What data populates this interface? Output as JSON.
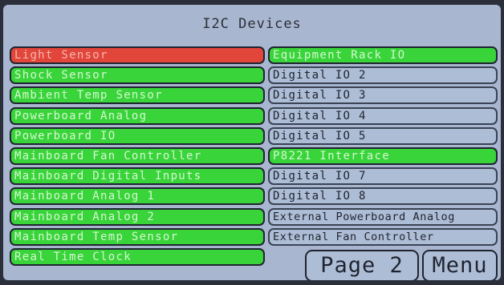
{
  "title": "I2C Devices",
  "left_items": [
    {
      "label": "Light Sensor",
      "status": "error"
    },
    {
      "label": "Shock Sensor",
      "status": "ok"
    },
    {
      "label": "Ambient Temp Sensor",
      "status": "ok"
    },
    {
      "label": "Powerboard Analog",
      "status": "ok"
    },
    {
      "label": "Powerboard IO",
      "status": "ok"
    },
    {
      "label": "Mainboard Fan Controller",
      "status": "ok"
    },
    {
      "label": "Mainboard Digital Inputs",
      "status": "ok"
    },
    {
      "label": "Mainboard Analog 1",
      "status": "ok"
    },
    {
      "label": "Mainboard Analog 2",
      "status": "ok"
    },
    {
      "label": "Mainboard Temp Sensor",
      "status": "ok"
    },
    {
      "label": "Real Time Clock",
      "status": "ok"
    }
  ],
  "right_items": [
    {
      "label": "Equipment Rack IO",
      "status": "ok"
    },
    {
      "label": "Digital IO 2",
      "status": "none"
    },
    {
      "label": "Digital IO 3",
      "status": "none"
    },
    {
      "label": "Digital IO 4",
      "status": "none"
    },
    {
      "label": "Digital IO 5",
      "status": "none"
    },
    {
      "label": "P8221 Interface",
      "status": "ok"
    },
    {
      "label": "Digital IO 7",
      "status": "none"
    },
    {
      "label": "Digital IO 8",
      "status": "none"
    },
    {
      "label": "External Powerboard Analog",
      "status": "none"
    },
    {
      "label": "External Fan Controller",
      "status": "none"
    }
  ],
  "buttons": {
    "page_label": "Page 2",
    "menu_label": "Menu"
  },
  "colors": {
    "ok": "#39d43a",
    "error": "#e2453a",
    "none": "#aebdd6",
    "background": "#a9b6cf"
  }
}
